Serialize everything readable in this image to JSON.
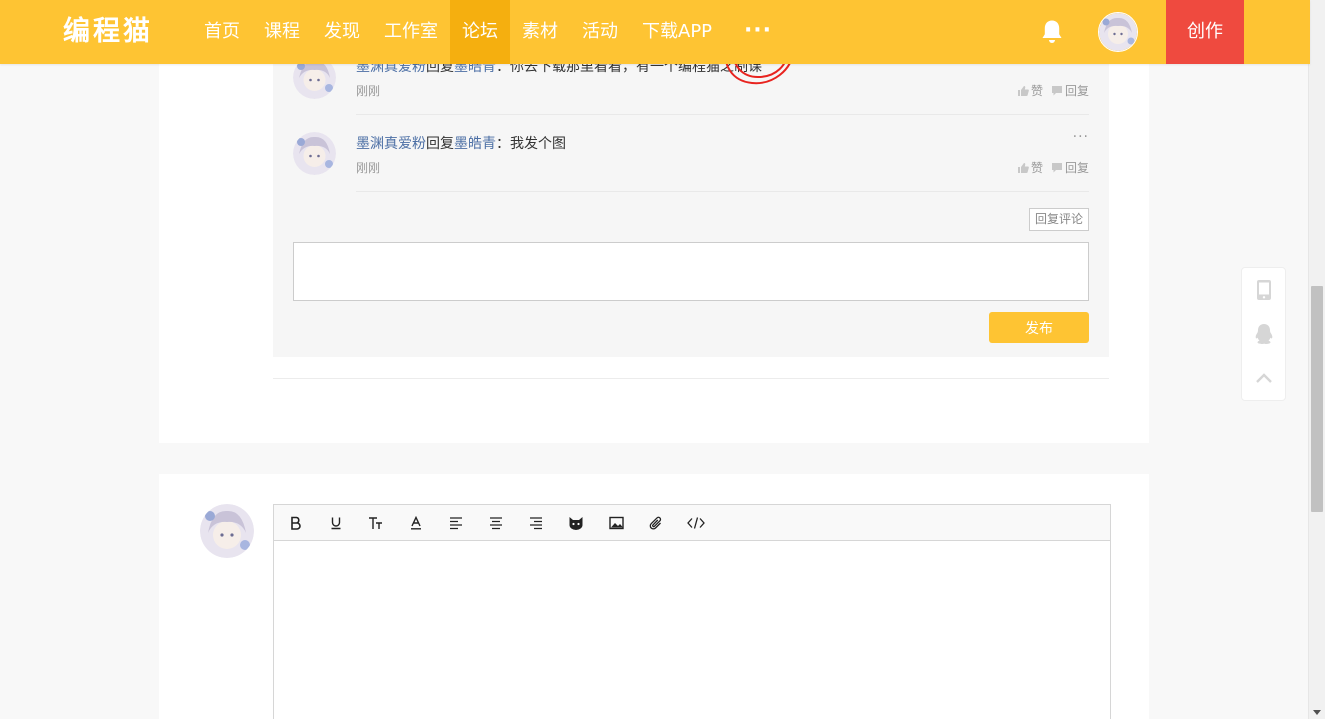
{
  "header": {
    "logo": "编程猫",
    "nav": [
      "首页",
      "课程",
      "发现",
      "工作室",
      "论坛",
      "素材",
      "活动",
      "下载APP"
    ],
    "active_index": 4,
    "more_label": "···",
    "create_label": "创作",
    "colors": {
      "brand": "#fec433",
      "active": "#f5af0f",
      "create": "#ef4a3f"
    }
  },
  "replies": [
    {
      "user": "墨渊真爱粉",
      "reply_word": "回复",
      "target": "墨皓青",
      "sep": "：",
      "content": "你去下载那里看看，有一个编程猫之制课",
      "time": "刚刚",
      "like": "赞",
      "reply": "回复"
    },
    {
      "user": "墨渊真爱粉",
      "reply_word": "回复",
      "target": "墨皓青",
      "sep": "：",
      "content": "我发个图",
      "time": "刚刚",
      "like": "赞",
      "reply": "回复",
      "more": "···"
    }
  ],
  "reply_panel": {
    "reply_comment_label": "回复评论",
    "publish_label": "发布"
  },
  "editor": {
    "toolbar": [
      "bold-icon",
      "underline-icon",
      "font-size-icon",
      "font-color-icon",
      "align-left-icon",
      "align-center-icon",
      "align-right-icon",
      "cat-emoji-icon",
      "image-icon",
      "attachment-icon",
      "code-icon"
    ]
  },
  "side_tools": [
    "mobile-icon",
    "qq-icon",
    "back-to-top-icon"
  ]
}
